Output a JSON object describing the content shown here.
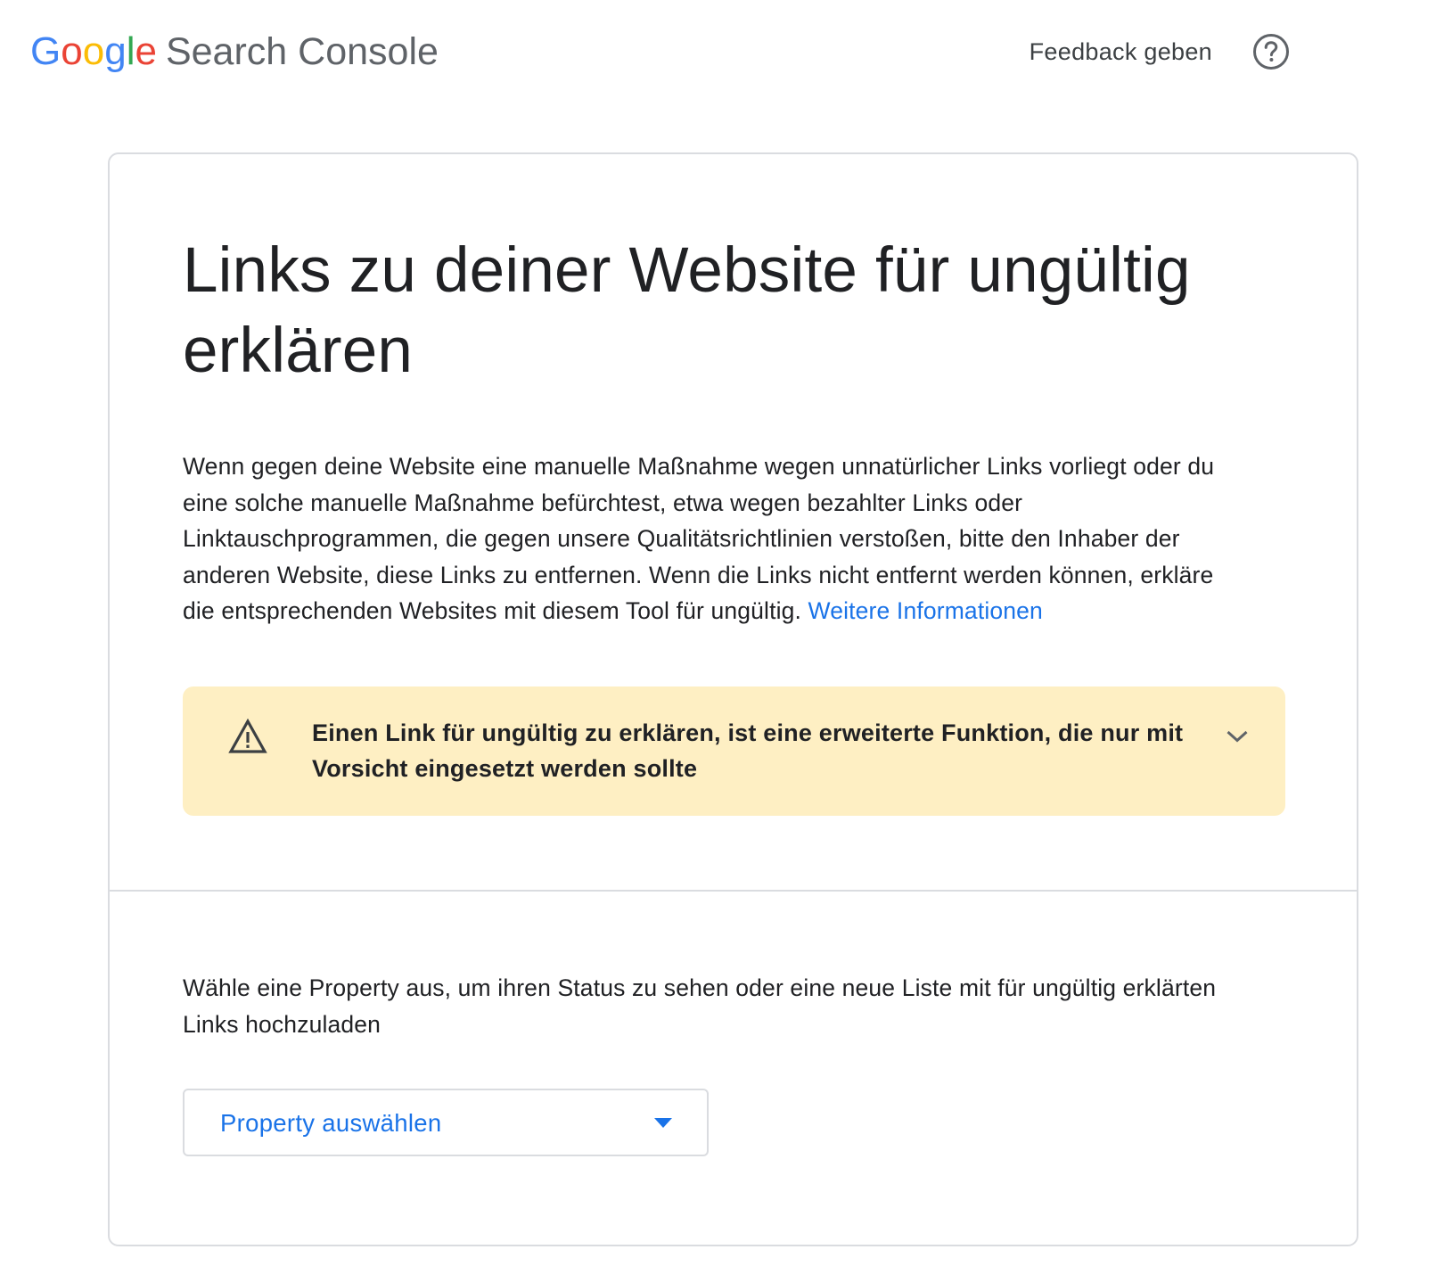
{
  "header": {
    "logo": {
      "google_letters": [
        {
          "char": "G",
          "color": "#4285f4"
        },
        {
          "char": "o",
          "color": "#ea4335"
        },
        {
          "char": "o",
          "color": "#fbbc05"
        },
        {
          "char": "g",
          "color": "#4285f4"
        },
        {
          "char": "l",
          "color": "#34a853"
        },
        {
          "char": "e",
          "color": "#ea4335"
        }
      ],
      "product_name": "Search Console"
    },
    "feedback_label": "Feedback geben",
    "help_icon": "help-circle-icon"
  },
  "main": {
    "title": "Links zu deiner Website für ungültig erklären",
    "description": "Wenn gegen deine Website eine manuelle Maßnahme wegen unnatürlicher Links vorliegt oder du eine solche manuelle Maßnahme befürchtest, etwa wegen bezahlter Links oder Linktauschprogrammen, die gegen unsere Qualitätsrichtlinien verstoßen, bitte den Inhaber der anderen Website, diese Links zu entfernen. Wenn die Links nicht entfernt werden können, erkläre die entsprechenden Websites mit diesem Tool für ungültig.",
    "learn_more_link": "Weitere Informationen",
    "warning": {
      "icon": "warning-triangle-icon",
      "text": "Einen Link für ungültig zu erklären, ist eine erweiterte Funktion, die nur mit Vorsicht eingesetzt werden sollte",
      "toggle_icon": "chevron-down-icon",
      "background_color": "#feefc3"
    },
    "property_prompt": "Wähle eine Property aus, um ihren Status zu sehen oder eine neue Liste mit für ungültig erklärten Links hochzuladen",
    "property_select": {
      "label": "Property auswählen",
      "icon": "dropdown-arrow-icon"
    }
  },
  "colors": {
    "accent": "#1a73e8",
    "text_primary": "#202124",
    "text_secondary": "#5f6368",
    "border": "#dadce0"
  }
}
